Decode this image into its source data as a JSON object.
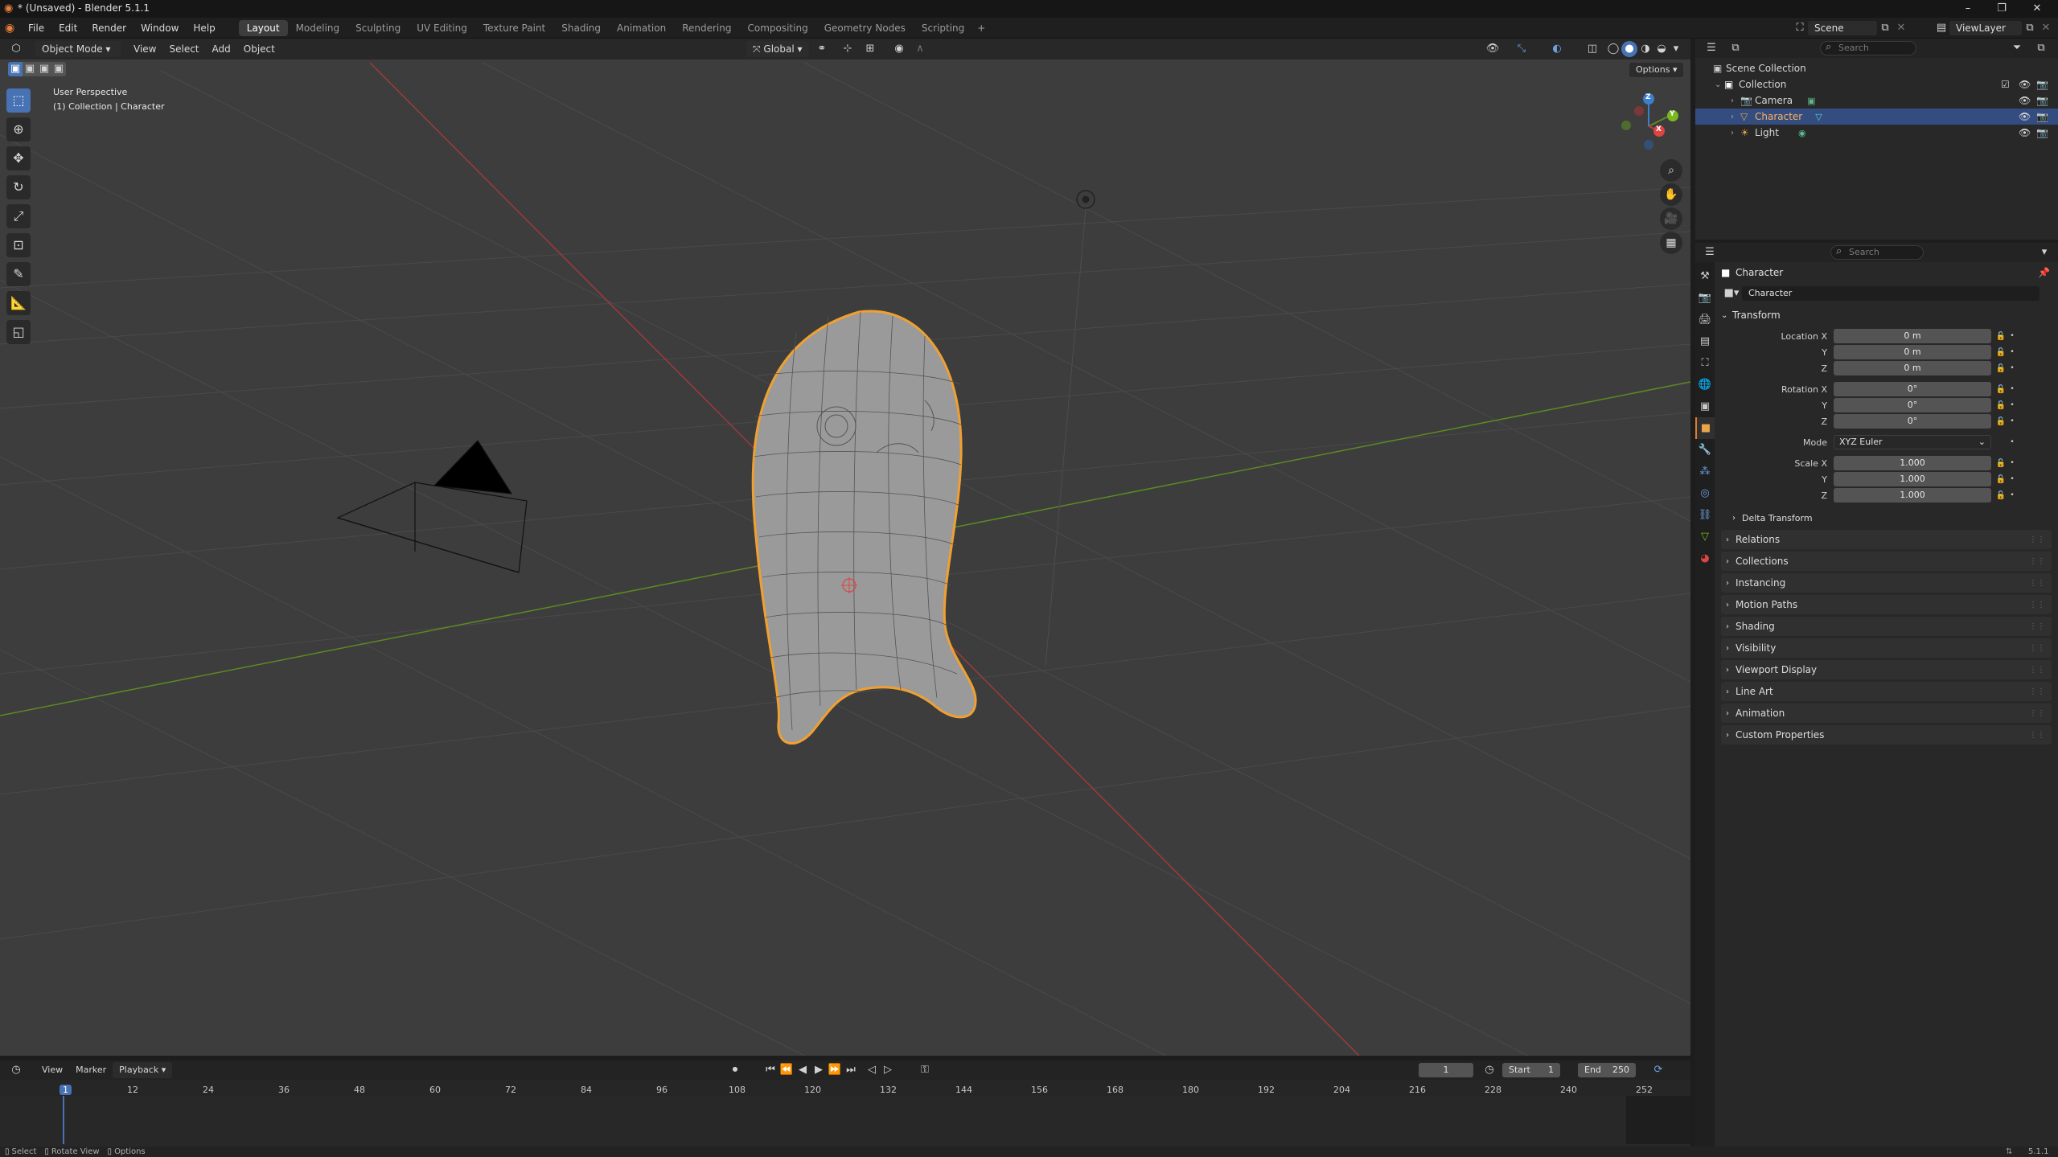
{
  "window": {
    "title": "* (Unsaved) - Blender 5.1.1"
  },
  "menubar": {
    "items": [
      "File",
      "Edit",
      "Render",
      "Window",
      "Help"
    ],
    "workspaces": [
      "Layout",
      "Modeling",
      "Sculpting",
      "UV Editing",
      "Texture Paint",
      "Shading",
      "Animation",
      "Rendering",
      "Compositing",
      "Geometry Nodes",
      "Scripting"
    ],
    "active_workspace": "Layout",
    "add_tab": "+",
    "scene": "Scene",
    "view_layer": "ViewLayer"
  },
  "viewport": {
    "mode": "Object Mode",
    "menus": [
      "View",
      "Select",
      "Add",
      "Object"
    ],
    "orientation": "Global",
    "options_label": "Options",
    "overlay_title": "User Perspective",
    "overlay_subtitle": "(1) Collection | Character",
    "gizmo": {
      "x": "X",
      "y": "Y",
      "z": "Z"
    }
  },
  "outliner": {
    "search_placeholder": "Search",
    "root": "Scene Collection",
    "items": [
      {
        "label": "Collection",
        "selected": false
      },
      {
        "label": "Camera",
        "selected": false
      },
      {
        "label": "Character",
        "selected": true
      },
      {
        "label": "Light",
        "selected": false
      }
    ]
  },
  "properties": {
    "search_placeholder": "Search",
    "object_name": "Character",
    "datablock_name": "Character",
    "transform_title": "Transform",
    "location": {
      "label_x": "Location X",
      "label_y": "Y",
      "label_z": "Z",
      "x": "0 m",
      "y": "0 m",
      "z": "0 m"
    },
    "rotation": {
      "label_x": "Rotation X",
      "label_y": "Y",
      "label_z": "Z",
      "x": "0°",
      "y": "0°",
      "z": "0°"
    },
    "mode_label": "Mode",
    "mode_value": "XYZ Euler",
    "scale": {
      "label_x": "Scale X",
      "label_y": "Y",
      "label_z": "Z",
      "x": "1.000",
      "y": "1.000",
      "z": "1.000"
    },
    "delta_transform": "Delta Transform",
    "panels": [
      "Relations",
      "Collections",
      "Instancing",
      "Motion Paths",
      "Shading",
      "Visibility",
      "Viewport Display",
      "Line Art",
      "Animation",
      "Custom Properties"
    ]
  },
  "timeline": {
    "menus": [
      "View",
      "Marker",
      "Playback"
    ],
    "current_frame": "1",
    "start_label": "Start",
    "start_value": "1",
    "end_label": "End",
    "end_value": "250",
    "ruler": [
      "1",
      "12",
      "24",
      "36",
      "48",
      "60",
      "72",
      "84",
      "96",
      "108",
      "120",
      "132",
      "144",
      "156",
      "168",
      "180",
      "192",
      "204",
      "216",
      "228",
      "240",
      "252"
    ],
    "playhead_label": "1"
  },
  "statusbar": {
    "select": "Select",
    "rotate": "Rotate View",
    "options": "Options",
    "version": "5.1.1"
  },
  "colors": {
    "accent": "#4772b3",
    "selection_outline": "#e89a30",
    "x_axis": "#c0393b",
    "y_axis": "#6a9a1f",
    "z_axis": "#3a7fd0"
  }
}
